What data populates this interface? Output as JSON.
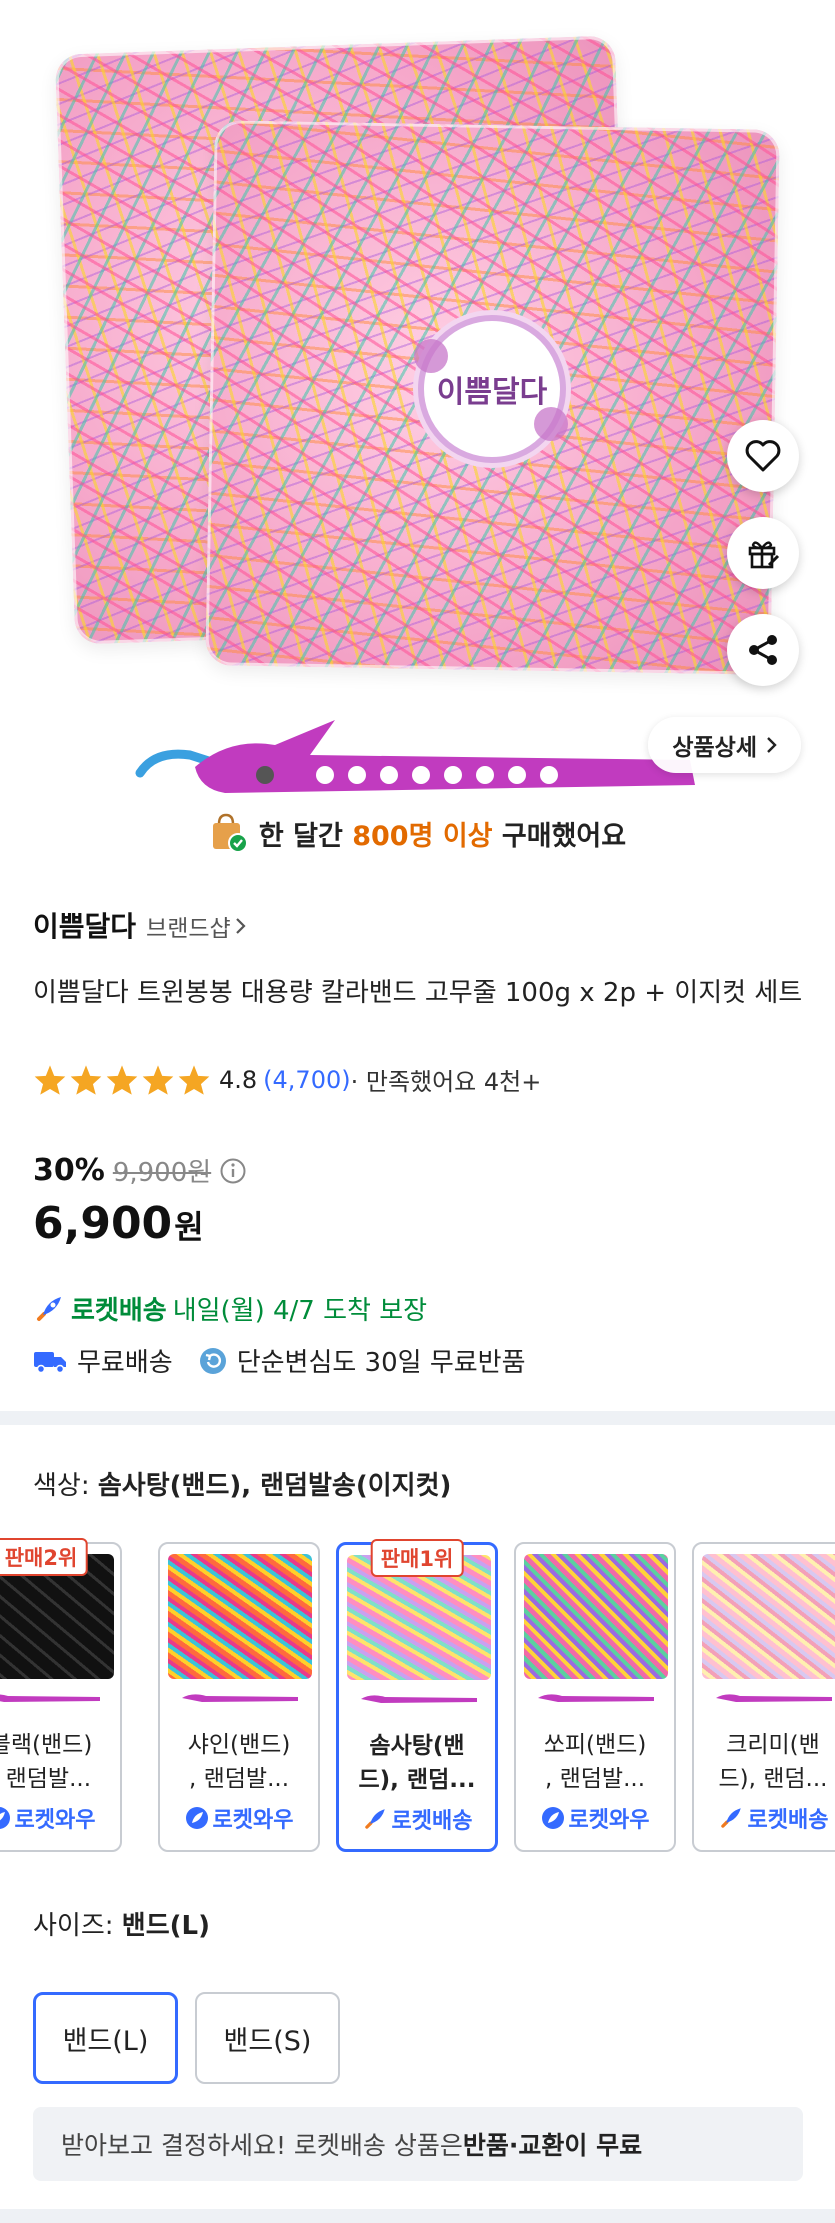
{
  "hero": {
    "brand_label_text": "이쁨달다",
    "detail_button": "상품상세",
    "sold_prefix": "한 달간 ",
    "sold_highlight": "800명 이상",
    "sold_suffix": " 구매했어요"
  },
  "product": {
    "brand": "이쁨달다",
    "brand_shop": "브랜드샵",
    "title": "이쁨달다 트윈봉봉 대용량 칼라밴드 고무줄 100g x 2p + 이지컷 세트",
    "rating": "4.8",
    "review_count": "(4,700)",
    "satisfaction": " · 만족했어요 4천+",
    "discount": "30%",
    "original_price": "9,900원",
    "price": "6,900",
    "price_unit": "원"
  },
  "delivery": {
    "rocket_label": "로켓배송",
    "rocket_eta": "내일(월) 4/7 도착 보장",
    "free_shipping": "무료배송",
    "free_return": "단순변심도 30일 무료반품"
  },
  "options": {
    "color_prefix": "색상: ",
    "color_value": "솜사탕(밴드), 랜덤발송(이지컷)",
    "swatches": [
      {
        "name": "블랙(밴드)\n, 랜덤발...",
        "badge": "로켓와우",
        "rank": "판매2위"
      },
      {
        "name": "샤인(밴드)\n, 랜덤발...",
        "badge": "로켓와우",
        "rank": ""
      },
      {
        "name": "솜사탕(밴\n드), 랜덤...",
        "badge": "로켓배송",
        "rank": "판매1위"
      },
      {
        "name": "쏘피(밴드)\n, 랜덤발...",
        "badge": "로켓와우",
        "rank": ""
      },
      {
        "name": "크리미(밴\n드), 랜덤...",
        "badge": "로켓배송",
        "rank": ""
      }
    ],
    "size_prefix": "사이즈: ",
    "size_value": "밴드(L)",
    "sizes": [
      "밴드(L)",
      "밴드(S)"
    ]
  },
  "notice": {
    "text": "받아보고 결정하세요! 로켓배송 상품은 ",
    "bold": "반품·교환이 무료"
  },
  "colors": {
    "accent": "#346aff",
    "rocket_green": "#008c3a",
    "rank_red": "#e0452f",
    "highlight_orange": "#e26a00"
  }
}
